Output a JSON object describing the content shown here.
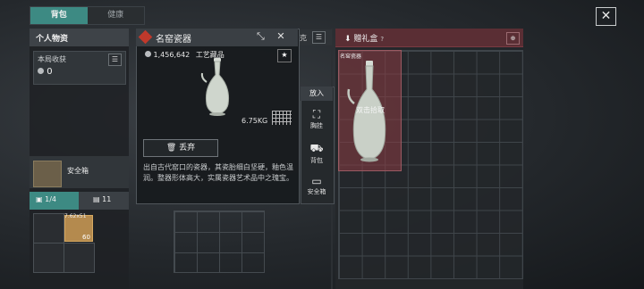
{
  "tabs": [
    {
      "label": "背包",
      "active": true
    },
    {
      "label": "健康",
      "active": false
    }
  ],
  "left_panel": {
    "title": "个人物资",
    "harvest_label": "本局收获",
    "harvest_value": "0",
    "safe_box_label": "安全箱",
    "capacity_a": "1/4",
    "capacity_b": "11",
    "crate_size": "7.62x51",
    "crate_count": "60"
  },
  "item_popup": {
    "name": "名窑瓷器",
    "price": "1,456,642",
    "category": "工艺藏品",
    "weight": "6.75KG",
    "discard_label": "丢弃",
    "description": "出自古代窑口的瓷器，其瓷胎细白坚硬，釉色温润。整器形体高大，实属瓷器艺术品中之瑰宝。",
    "rarity_color": "#c0392b"
  },
  "action_menu": {
    "title": "放入",
    "items": [
      {
        "label": "胸挂",
        "icon": "vest-icon"
      },
      {
        "label": "背包",
        "icon": "backpack-icon"
      },
      {
        "label": "安全箱",
        "icon": "safe-icon"
      }
    ]
  },
  "right_panel": {
    "title": "赠礼盒",
    "title_suffix": "?",
    "slot_label": "名窑瓷器",
    "pickup_hint": "双击拾取",
    "header_color": "#5a2e34"
  },
  "partial_label": "克"
}
